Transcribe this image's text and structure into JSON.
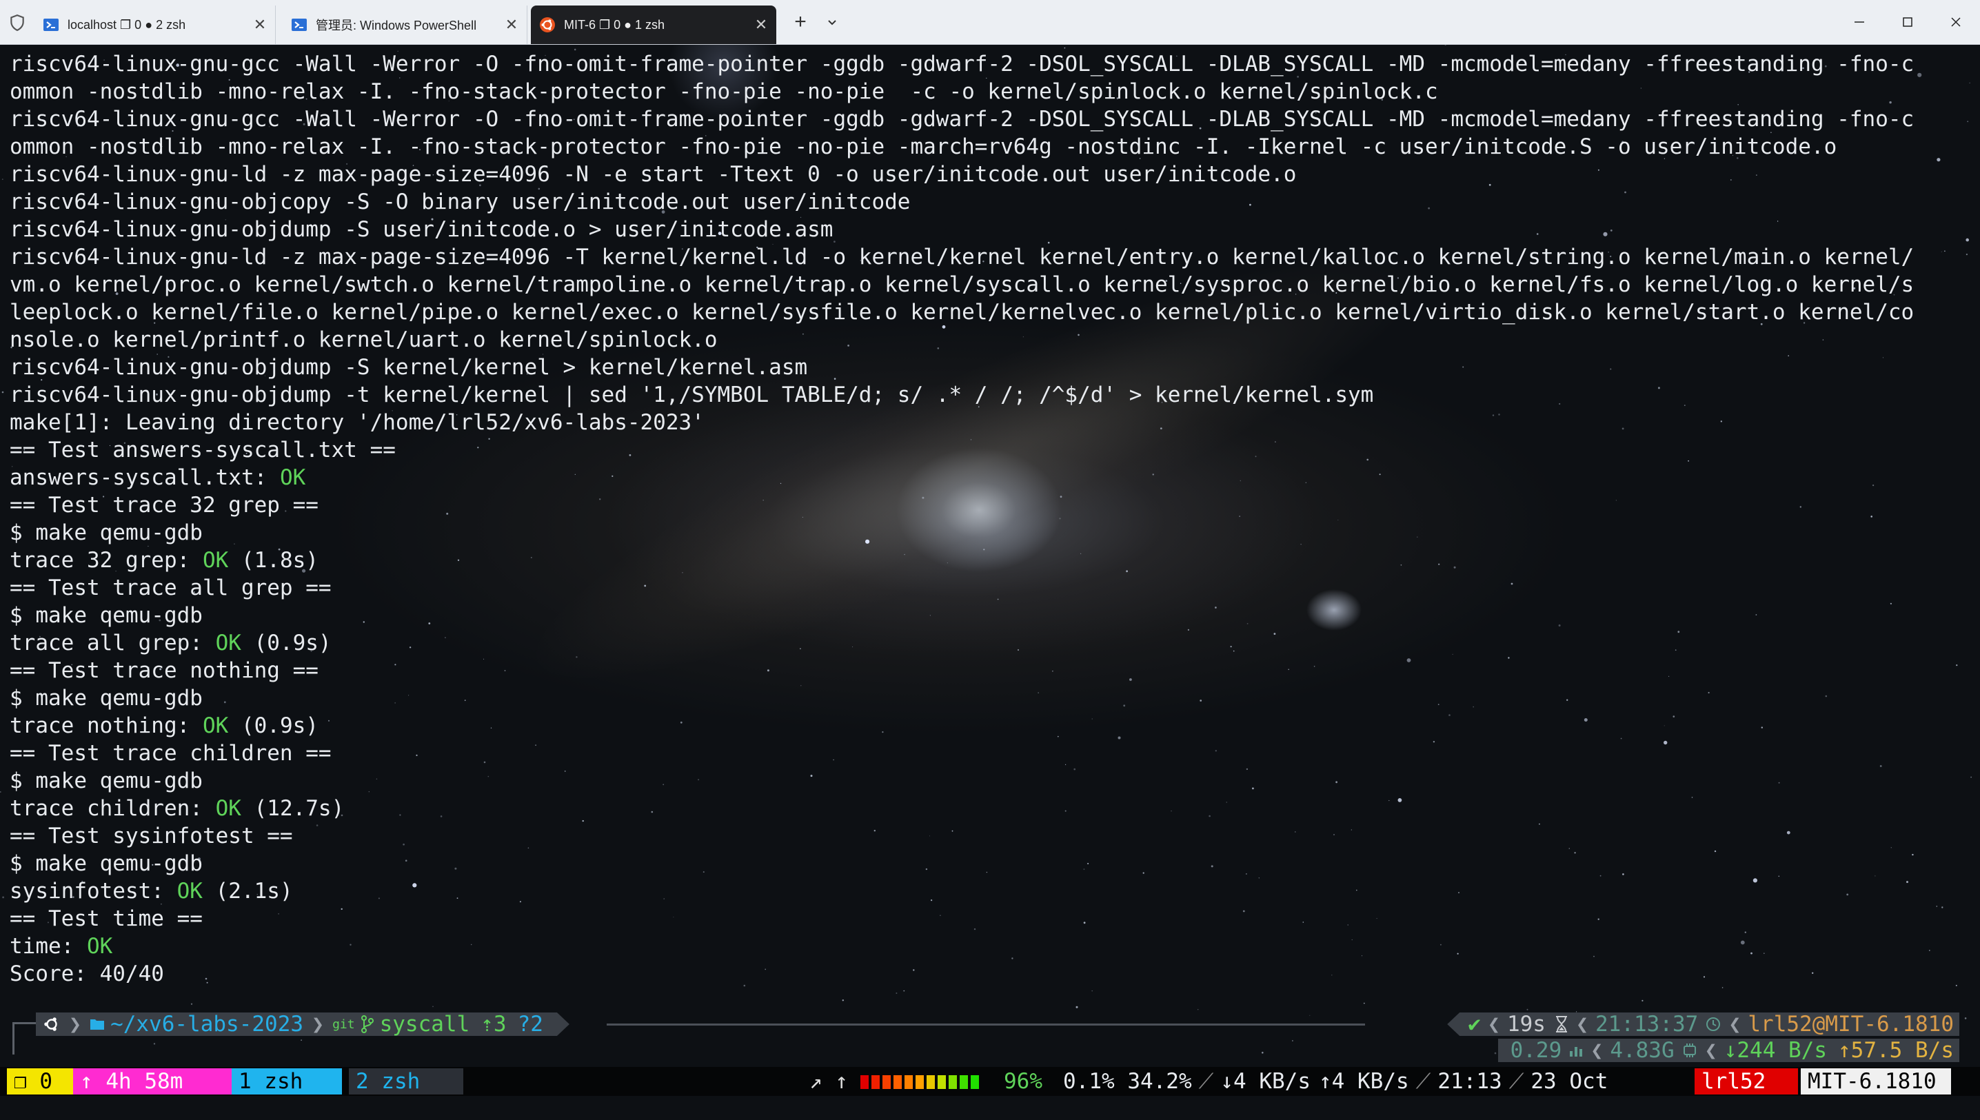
{
  "tabs": [
    {
      "label": "localhost ❐ 0 ● 2 zsh",
      "icon": "powershell-icon",
      "active": false
    },
    {
      "label": "管理员: Windows PowerShell",
      "icon": "powershell-icon",
      "active": false
    },
    {
      "label": "MIT-6 ❐ 0 ● 1 zsh",
      "icon": "ubuntu-icon",
      "active": true
    }
  ],
  "tabbar": {
    "new_tab": "+",
    "close_glyph": "✕"
  },
  "window": {
    "minimize": "—",
    "maximize": "☐",
    "close": "✕"
  },
  "output": {
    "lines": [
      "riscv64-linux-gnu-gcc -Wall -Werror -O -fno-omit-frame-pointer -ggdb -gdwarf-2 -DSOL_SYSCALL -DLAB_SYSCALL -MD -mcmodel=medany -ffreestanding -fno-c",
      "ommon -nostdlib -mno-relax -I. -fno-stack-protector -fno-pie -no-pie  -c -o kernel/spinlock.o kernel/spinlock.c",
      "riscv64-linux-gnu-gcc -Wall -Werror -O -fno-omit-frame-pointer -ggdb -gdwarf-2 -DSOL_SYSCALL -DLAB_SYSCALL -MD -mcmodel=medany -ffreestanding -fno-c",
      "ommon -nostdlib -mno-relax -I. -fno-stack-protector -fno-pie -no-pie -march=rv64g -nostdinc -I. -Ikernel -c user/initcode.S -o user/initcode.o",
      "riscv64-linux-gnu-ld -z max-page-size=4096 -N -e start -Ttext 0 -o user/initcode.out user/initcode.o",
      "riscv64-linux-gnu-objcopy -S -O binary user/initcode.out user/initcode",
      "riscv64-linux-gnu-objdump -S user/initcode.o > user/initcode.asm",
      "riscv64-linux-gnu-ld -z max-page-size=4096 -T kernel/kernel.ld -o kernel/kernel kernel/entry.o kernel/kalloc.o kernel/string.o kernel/main.o kernel/",
      "vm.o kernel/proc.o kernel/swtch.o kernel/trampoline.o kernel/trap.o kernel/syscall.o kernel/sysproc.o kernel/bio.o kernel/fs.o kernel/log.o kernel/s",
      "leeplock.o kernel/file.o kernel/pipe.o kernel/exec.o kernel/sysfile.o kernel/kernelvec.o kernel/plic.o kernel/virtio_disk.o kernel/start.o kernel/co",
      "nsole.o kernel/printf.o kernel/uart.o kernel/spinlock.o",
      "riscv64-linux-gnu-objdump -S kernel/kernel > kernel/kernel.asm",
      "riscv64-linux-gnu-objdump -t kernel/kernel | sed '1,/SYMBOL TABLE/d; s/ .* / /; /^$/d' > kernel/kernel.sym",
      "make[1]: Leaving directory '/home/lrl52/xv6-labs-2023'",
      "== Test answers-syscall.txt ==",
      {
        "pre": "answers-syscall.txt: ",
        "ok": "OK",
        "post": ""
      },
      "== Test trace 32 grep ==",
      "$ make qemu-gdb",
      {
        "pre": "trace 32 grep: ",
        "ok": "OK",
        "post": " (1.8s)"
      },
      "== Test trace all grep ==",
      "$ make qemu-gdb",
      {
        "pre": "trace all grep: ",
        "ok": "OK",
        "post": " (0.9s)"
      },
      "== Test trace nothing ==",
      "$ make qemu-gdb",
      {
        "pre": "trace nothing: ",
        "ok": "OK",
        "post": " (0.9s)"
      },
      "== Test trace children ==",
      "$ make qemu-gdb",
      {
        "pre": "trace children: ",
        "ok": "OK",
        "post": " (12.7s)"
      },
      "== Test sysinfotest ==",
      "$ make qemu-gdb",
      {
        "pre": "sysinfotest: ",
        "ok": "OK",
        "post": " (2.1s)"
      },
      "== Test time ==",
      {
        "pre": "time: ",
        "ok": "OK",
        "post": ""
      },
      "Score: 40/40"
    ]
  },
  "prompt": {
    "os_icon": "ubuntu-icon",
    "dir": "~/xv6-labs-2023",
    "git_label": "git",
    "branch": "syscall",
    "ahead": "⇡3",
    "untracked": "?2",
    "status_ok": "✔",
    "duration": "19s",
    "time": "21:13:37",
    "user_host": "lrl52@MIT-6.1810",
    "load": "0.29",
    "ram": "4.83G",
    "down": "↓244 B/s",
    "up": "↑57.5 B/s"
  },
  "status": {
    "session": "❐ 0",
    "uptime": "↑ 4h 58m",
    "window1": "1 zsh",
    "window2": "2 zsh",
    "arrows": "↗ ↑",
    "cpu_level": 0.96,
    "cpu": "96%",
    "cpu_breakdown": "0.1% 34.2%",
    "net_down": "↓4 KB/s",
    "net_up": "↑4 KB/s",
    "time": "21:13",
    "date": "23 Oct",
    "user": "lrl52",
    "host": "MIT-6.1810"
  },
  "colors": {
    "ok": "#5fd35a",
    "dir": "#27aee6",
    "session": "#f4e500",
    "uptime": "#ff2bd1",
    "window": "#1fb4ee",
    "user": "#e00000"
  }
}
